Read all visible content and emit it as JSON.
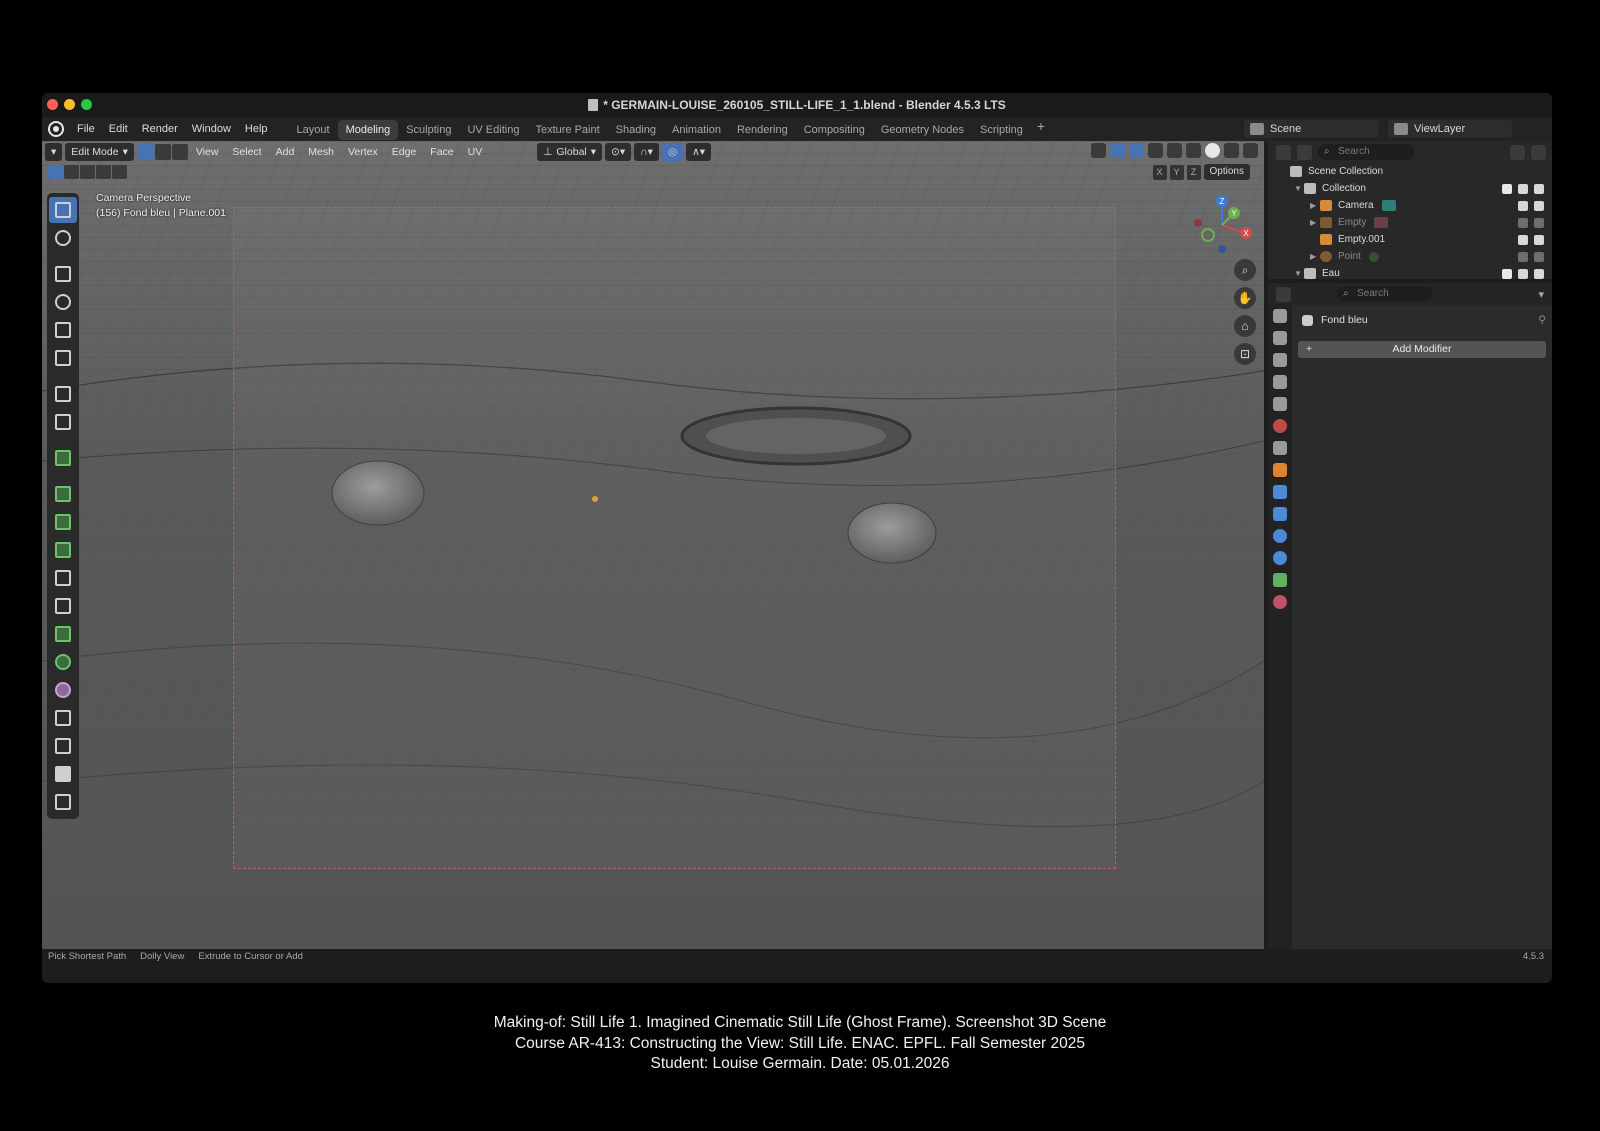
{
  "window": {
    "title": "* GERMAIN-LOUISE_260105_STILL-LIFE_1_1.blend - Blender 4.5.3 LTS"
  },
  "menubar": {
    "items": [
      "File",
      "Edit",
      "Render",
      "Window",
      "Help"
    ]
  },
  "workspaces": {
    "tabs": [
      "Layout",
      "Modeling",
      "Sculpting",
      "UV Editing",
      "Texture Paint",
      "Shading",
      "Animation",
      "Rendering",
      "Compositing",
      "Geometry Nodes",
      "Scripting"
    ],
    "active": "Modeling",
    "add": "+"
  },
  "scene": {
    "name": "Scene",
    "view_layer": "ViewLayer"
  },
  "viewport_header": {
    "mode": "Edit Mode",
    "menus": [
      "View",
      "Select",
      "Add",
      "Mesh",
      "Vertex",
      "Edge",
      "Face",
      "UV"
    ],
    "transform_orientation": "Global",
    "axes": [
      "X",
      "Y",
      "Z"
    ],
    "options": "Options"
  },
  "viewport": {
    "view_name": "Camera Perspective",
    "object_info": "(156) Fond bleu | Plane.001",
    "gizmo_axes": {
      "x": "X",
      "y": "Y",
      "z": "Z"
    }
  },
  "outliner": {
    "search_placeholder": "Search",
    "rows": [
      {
        "label": "Scene Collection",
        "level": 0
      },
      {
        "label": "Collection",
        "level": 1
      },
      {
        "label": "Camera",
        "level": 2
      },
      {
        "label": "Empty",
        "level": 2
      },
      {
        "label": "Empty.001",
        "level": 2
      },
      {
        "label": "Point",
        "level": 2
      },
      {
        "label": "Eau",
        "level": 1
      }
    ]
  },
  "properties": {
    "search_placeholder": "Search",
    "object_name": "Fond bleu",
    "add_modifier": "Add Modifier"
  },
  "statusbar": {
    "hints": [
      "Pick Shortest Path",
      "Dolly View",
      "Extrude to Cursor or Add"
    ],
    "version": "4.5.3"
  },
  "caption": {
    "line1": "Making-of: Still Life 1. Imagined Cinematic Still Life (Ghost Frame). Screenshot 3D Scene",
    "line2": "Course AR-413: Constructing the View: Still Life. ENAC. EPFL. Fall Semester 2025",
    "line3": "Student: Louise Germain. Date: 05.01.2026"
  },
  "colors": {
    "accent": "#4772b3",
    "close": "#fe5f57",
    "minimize": "#febc2e",
    "maximize": "#28c840"
  }
}
